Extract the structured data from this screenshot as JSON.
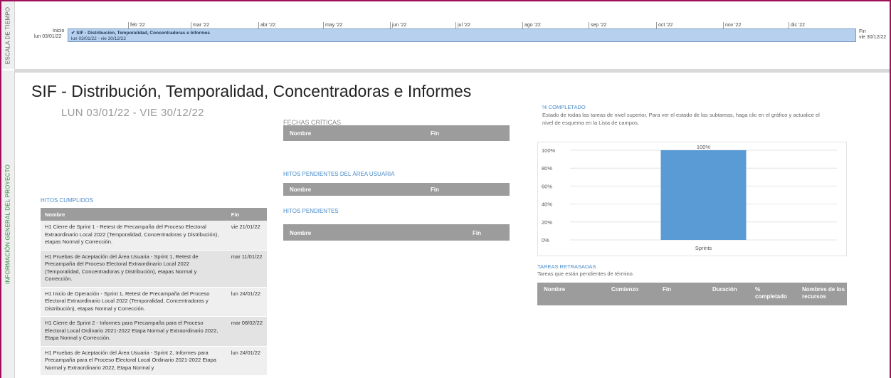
{
  "side_labels": {
    "timeline": "ESCALA DE TIEMPO",
    "overview": "INFORMACIÓN GENERAL DEL PROYECTO"
  },
  "timeline": {
    "start_label": "Inicio",
    "start_date": "lun 03/01/22",
    "end_label": "Fin",
    "end_date": "vie 30/12/22",
    "months": [
      "feb '22",
      "mar '22",
      "abr '22",
      "may '22",
      "jun '22",
      "jul '22",
      "ago '22",
      "sep '22",
      "oct '22",
      "nov '22",
      "dic '22"
    ],
    "bar_title": "SIF - Distribución, Temporalidad, Concentradoras  e Informes",
    "bar_dates": "lun 03/01/22 - vie 30/12/22"
  },
  "report": {
    "title": "SIF - Distribución, Temporalidad, Concentradoras  e Informes",
    "date_range": "LUN 03/01/22  -  VIE 30/12/22"
  },
  "hitos_cumplidos": {
    "label": "HITOS CUMPLIDOS",
    "columns": [
      "Nombre",
      "Fin"
    ],
    "rows": [
      [
        "H1 Cierre de Sprint 1 - Retest de Precampaña del Proceso Electoral Extraordinario Local 2022 (Temporalidad, Concentradoras y Distribución), etapas Normal y Corrección.",
        "vie 21/01/22"
      ],
      [
        "H1 Pruebas de Aceptación del Área Usuaria - Sprint 1, Retest de Precampaña del Proceso Electoral Extraordinario Local 2022 (Temporalidad, Concentradoras y Distribución), etapas Normal y Corrección.",
        "mar 11/01/22"
      ],
      [
        "H1 Inicio de Operación - Sprint 1, Retest de Precampaña del Proceso Electoral Extraordinario Local 2022 (Temporalidad, Concentradoras y Distribución), etapas Normal y Corrección.",
        "lun 24/01/22"
      ],
      [
        "H1 Cierre de Sprint 2 - Informes para Precampaña para el Proceso Electoral Local Ordinario 2021-2022 Etapa Normal y Extraordinario 2022, Etapa Normal y Corrección.",
        "mar 08/02/22"
      ],
      [
        "H1 Pruebas de Aceptación del Área Usuaria - Sprint 2, Informes para Precampaña para el Proceso Electoral Local Ordinario 2021-2022 Etapa Normal y Extraordinario 2022, Etapa Normal y",
        "lun 24/01/22"
      ]
    ]
  },
  "fechas_criticas": {
    "label": "FECHAS CRÍTICAS",
    "columns": [
      "Nombre",
      "Fin"
    ]
  },
  "hitos_pend_usuaria": {
    "label": "HITOS PENDIENTES DEL ÁREA USUARIA",
    "columns": [
      "Nombre",
      "Fin"
    ]
  },
  "hitos_pendientes": {
    "label": "HITOS PENDIENTES",
    "columns": [
      "Nombre",
      "Fin"
    ]
  },
  "completado": {
    "label": "% COMPLETADO",
    "description": "Estado de todas las tareas de nivel superior. Para ver el estado de las subtareas, haga clic en el gráfico y actualice el nivel de esquema en la Lista de campos."
  },
  "tareas_retrasadas": {
    "label": "TAREAS RETRASADAS",
    "description": "Tareas que están pendientes de término.",
    "columns": [
      "Nombre",
      "Comienzo",
      "Fin",
      "Duración",
      "% completado",
      "Nombres de los recursos"
    ]
  },
  "chart_data": {
    "type": "bar",
    "categories": [
      "Sprints"
    ],
    "values": [
      100
    ],
    "data_labels": [
      "100%"
    ],
    "y_ticks": [
      "0%",
      "20%",
      "40%",
      "60%",
      "80%",
      "100%"
    ],
    "ylim": [
      0,
      100
    ],
    "bar_color": "#5b9bd5",
    "grid": true
  }
}
